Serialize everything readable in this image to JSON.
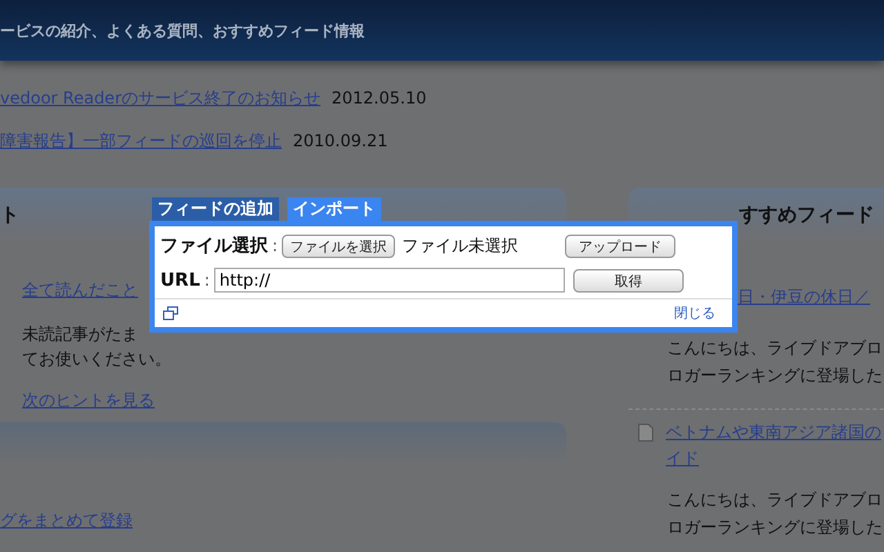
{
  "header": {
    "text": "ービスの紹介、よくある質問、おすすめフィード情報"
  },
  "news": [
    {
      "title": "vedoor Readerのサービス終了のお知らせ",
      "date": "2012.05.10"
    },
    {
      "title": "障害報告】一部フィードの巡回を停止",
      "date": "2010.09.21"
    }
  ],
  "left_panel": {
    "title": "ト",
    "link": "全て読んだこと",
    "lines": [
      "未読記事がたま",
      "てお使いください。"
    ],
    "hint_link": "次のヒントを見る"
  },
  "left_panel_2": {
    "link": "グをまとめて登録"
  },
  "right_panel": {
    "title": "すすめフィード",
    "items": [
      {
        "doc_icon": false,
        "title_lines": [
          "日・伊豆の休日／"
        ],
        "lines": [
          "こんにちは、ライブドアブロ",
          "ロガーランキングに登場した"
        ]
      },
      {
        "doc_icon": true,
        "title_lines": [
          "ベトナムや東南アジア諸国の",
          "イド"
        ],
        "lines": [
          "こんにちは、ライブドアブロ",
          "ロガーランキングに登場した"
        ]
      }
    ]
  },
  "dialog": {
    "tabs": [
      {
        "label": "フィードの追加",
        "selected": false
      },
      {
        "label": "インポート",
        "selected": true
      }
    ],
    "file_label": "ファイル選択",
    "separator": ":",
    "choose_button": "ファイルを選択",
    "file_status": "ファイル未選択",
    "upload_button": "アップロード",
    "url_label": "URL",
    "url_value": "http://",
    "fetch_button": "取得",
    "close_link": "閉じる"
  }
}
